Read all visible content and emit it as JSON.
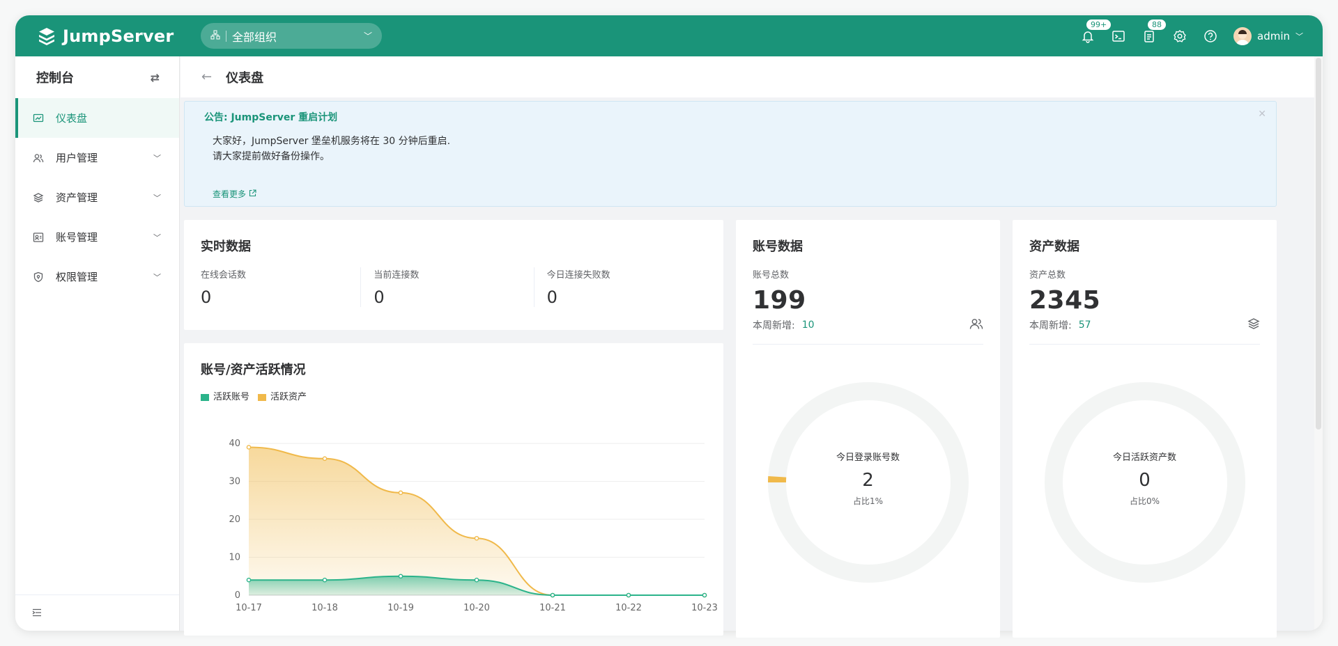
{
  "header": {
    "logo_text": "JumpServer",
    "org": "全部组织",
    "notification_badge": "99+",
    "ticket_badge": "88",
    "username": "admin"
  },
  "sidebar": {
    "title": "控制台",
    "items": [
      {
        "label": "仪表盘",
        "icon": "dashboard-icon"
      },
      {
        "label": "用户管理",
        "icon": "users-icon"
      },
      {
        "label": "资产管理",
        "icon": "layers-icon"
      },
      {
        "label": "账号管理",
        "icon": "account-icon"
      },
      {
        "label": "权限管理",
        "icon": "shield-icon"
      }
    ]
  },
  "page": {
    "title": "仪表盘"
  },
  "announcement": {
    "title": "公告: JumpServer 重启计划",
    "line1": "大家好，JumpServer 堡垒机服务将在 30 分钟后重启.",
    "line2": "请大家提前做好备份操作。",
    "more": "查看更多"
  },
  "realtime": {
    "title": "实时数据",
    "stats": [
      {
        "label": "在线会话数",
        "value": "0"
      },
      {
        "label": "当前连接数",
        "value": "0"
      },
      {
        "label": "今日连接失败数",
        "value": "0"
      }
    ]
  },
  "accounts": {
    "title": "账号数据",
    "total_label": "账号总数",
    "total": "199",
    "week_label": "本周新增:",
    "week_value": "10",
    "donut_label": "今日登录账号数",
    "donut_value": "2",
    "donut_percent": "占比1%",
    "donut_fraction": 0.01
  },
  "assets": {
    "title": "资产数据",
    "total_label": "资产总数",
    "total": "2345",
    "week_label": "本周新增:",
    "week_value": "57",
    "donut_label": "今日活跃资产数",
    "donut_value": "0",
    "donut_percent": "占比0%",
    "donut_fraction": 0
  },
  "activity": {
    "title": "账号/资产活跃情况"
  },
  "colors": {
    "brand": "#1a9479",
    "accounts_series": "#2bb38a",
    "assets_series": "#f0b94a"
  },
  "chart_data": {
    "type": "area",
    "x": [
      "10-17",
      "10-18",
      "10-19",
      "10-20",
      "10-21",
      "10-22",
      "10-23"
    ],
    "series": [
      {
        "name": "活跃账号",
        "values": [
          4,
          4,
          5,
          4,
          0,
          0,
          0
        ]
      },
      {
        "name": "活跃资产",
        "values": [
          39,
          36,
          27,
          15,
          0,
          0,
          0
        ]
      }
    ],
    "yticks": [
      0,
      10,
      20,
      30,
      40
    ],
    "ylim": [
      0,
      40
    ],
    "grid": true,
    "legend": "top-left"
  }
}
